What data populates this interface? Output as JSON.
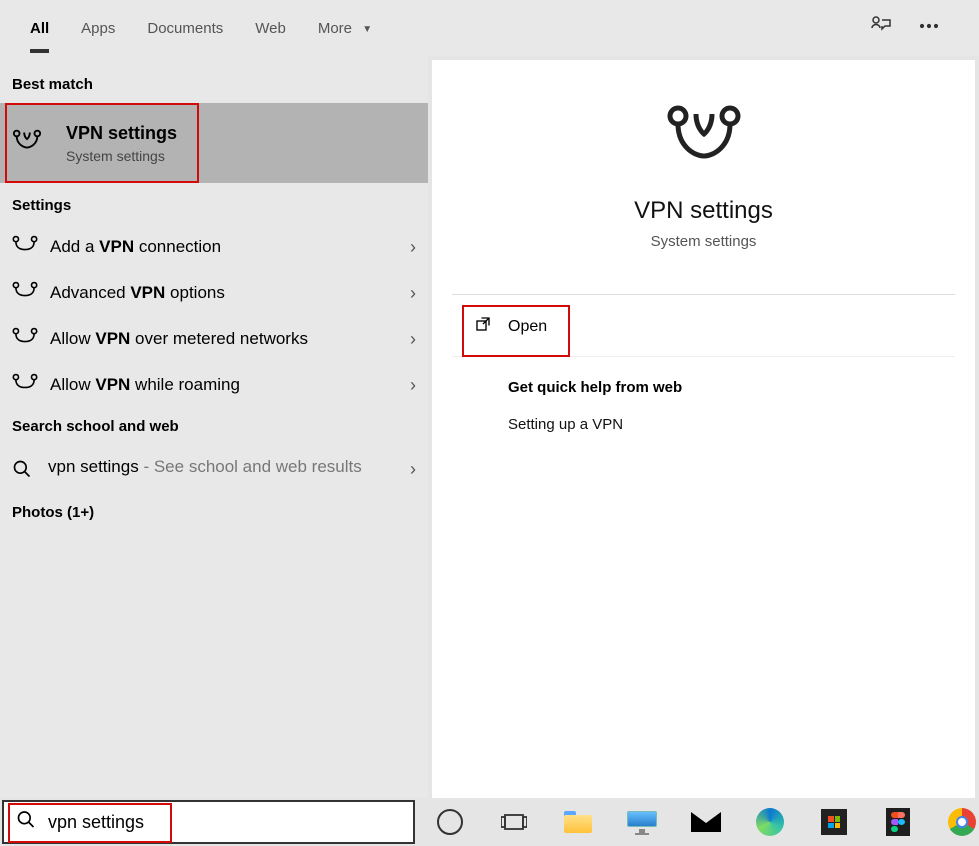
{
  "tabs": {
    "all": "All",
    "apps": "Apps",
    "documents": "Documents",
    "web": "Web",
    "more": "More"
  },
  "left": {
    "best_match_label": "Best match",
    "best_match": {
      "title": "VPN settings",
      "subtitle": "System settings"
    },
    "settings_label": "Settings",
    "settings_items": {
      "add_pre": "Add a ",
      "add_bold": "VPN",
      "add_post": " connection",
      "adv_pre": "Advanced ",
      "adv_bold": "VPN",
      "adv_post": " options",
      "metered_pre": "Allow ",
      "metered_bold": "VPN",
      "metered_post": " over metered networks",
      "roam_pre": "Allow ",
      "roam_bold": "VPN",
      "roam_post": " while roaming"
    },
    "search_web_label": "Search school and web",
    "search_web_item": {
      "query": "vpn settings",
      "suffix": " - See school and web results"
    },
    "photos_label": "Photos (1+)"
  },
  "right": {
    "title": "VPN settings",
    "subtitle": "System settings",
    "open": "Open",
    "quick_help_label": "Get quick help from web",
    "quick_help_link": "Setting up a VPN"
  },
  "search": {
    "value": "vpn settings"
  }
}
